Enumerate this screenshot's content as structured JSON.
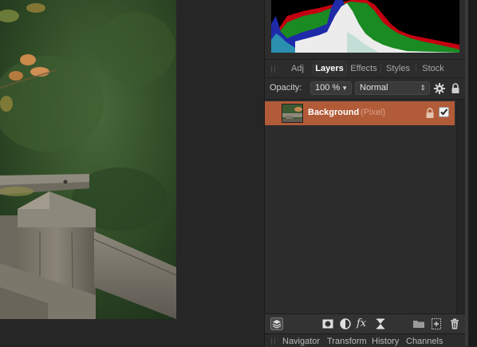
{
  "tabs": {
    "adj": "Adj",
    "layers": "Layers",
    "effects": "Effects",
    "styles": "Styles",
    "stock": "Stock"
  },
  "opacity": {
    "label": "Opacity:",
    "value": "100 %",
    "blend_mode": "Normal"
  },
  "layer": {
    "name": "Background",
    "type": "(Pixel)",
    "visible": true
  },
  "bottom_tabs": {
    "navigator": "Navigator",
    "transform": "Transform",
    "history": "History",
    "channels": "Channels"
  },
  "colors": {
    "selection": "#b25b38",
    "panel_bg": "#2c2c2c",
    "histogram_red": "#c40010",
    "histogram_green": "#1a8a22",
    "histogram_blue": "#1e2aa8"
  },
  "icons": {
    "panel_bottom": [
      "layers-stack-icon",
      "mask-icon",
      "adjustment-icon",
      "fx-icon",
      "hourglass-icon",
      "folder-icon",
      "add-layer-icon",
      "trash-icon"
    ],
    "opacity_row": [
      "gear-icon",
      "lock-icon"
    ]
  }
}
